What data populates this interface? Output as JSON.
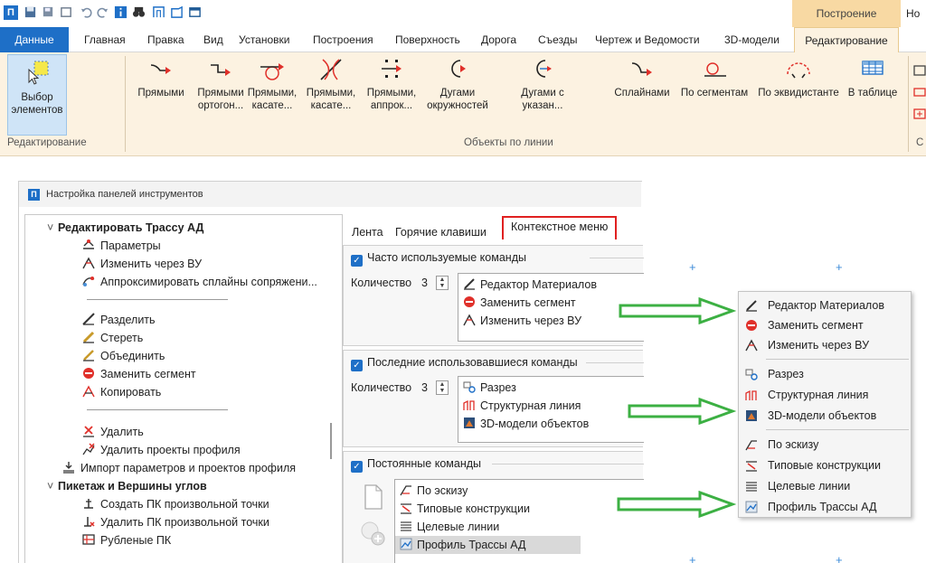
{
  "qat": {
    "logo": "П"
  },
  "contextual_tabs": {
    "build": "Построение",
    "more": "Но"
  },
  "tabs": [
    "Данные",
    "Главная",
    "Правка",
    "Вид",
    "Установки",
    "Построения",
    "Поверхность",
    "Дорога",
    "Съезды",
    "Чертеж и Ведомости",
    "3D-модели",
    "Редактирование"
  ],
  "ribbon": {
    "select_label": "Выбор\nэлементов",
    "group_edit": "Редактирование",
    "group_objects": "Объекты по линии",
    "group_more": "С",
    "buttons": [
      {
        "label": "Прямыми",
        "icon": "line-icon"
      },
      {
        "label": "Прямыми\nортогон...",
        "icon": "ortho-line-icon"
      },
      {
        "label": "Прямыми,\nкасате...",
        "icon": "tangent-circle-line-icon"
      },
      {
        "label": "Прямыми,\nкасате...",
        "icon": "tangent-arcs-line-icon"
      },
      {
        "label": "Прямыми,\nаппрок...",
        "icon": "approx-line-icon"
      },
      {
        "label": "Дугами\nокружностей",
        "icon": "arc-icon"
      },
      {
        "label": "Дугами с\nуказан...",
        "icon": "arc-direction-icon"
      },
      {
        "label": "Сплайнами",
        "icon": "spline-icon"
      },
      {
        "label": "По сегментам",
        "icon": "segments-icon"
      },
      {
        "label": "По эквидистанте",
        "icon": "equidistant-icon"
      },
      {
        "label": "В таблице",
        "icon": "table-icon"
      }
    ]
  },
  "dialog": {
    "logo": "П",
    "title": "Настройка панелей инструментов",
    "tree": {
      "section1": "Редактировать Трассу АД",
      "group1": [
        "Параметры",
        "Изменить через ВУ",
        "Аппроксимировать сплайны сопряжени..."
      ],
      "group2": [
        "Разделить",
        "Стереть",
        "Объединить",
        "Заменить сегмент",
        "Копировать"
      ],
      "group3": [
        "Удалить",
        "Удалить проекты профиля"
      ],
      "import": "Импорт параметров и проектов профиля",
      "section2": "Пикетаж и Вершины углов",
      "group4": [
        "Создать ПК произвольной точки",
        "Удалить ПК произвольной точки",
        "Рубленые ПК"
      ]
    },
    "tabs": [
      "Лента",
      "Горячие клавиши",
      "Контекстное меню"
    ],
    "frequent": {
      "title": "Часто используемые команды",
      "qty_label": "Количество",
      "qty": "3",
      "items": [
        "Редактор Материалов",
        "Заменить сегмент",
        "Изменить через ВУ"
      ]
    },
    "recent": {
      "title": "Последние использовавшиеся команды",
      "qty_label": "Количество",
      "qty": "3",
      "items": [
        "Разрез",
        "Структурная линия",
        "3D-модели объектов"
      ]
    },
    "permanent": {
      "title": "Постоянные команды",
      "items": [
        "По эскизу",
        "Типовые конструкции",
        "Целевые линии",
        "Профиль Трассы АД"
      ]
    }
  },
  "context_menu": {
    "section1": [
      "Редактор Материалов",
      "Заменить сегмент",
      "Изменить через ВУ"
    ],
    "section2": [
      "Разрез",
      "Структурная линия",
      "3D-модели объектов"
    ],
    "section3": [
      "По эскизу",
      "Типовые конструкции",
      "Целевые линии",
      "Профиль Трассы АД"
    ]
  },
  "colors": {
    "brand": "#1e6fc7",
    "ribbon_bg": "#fcf2e1",
    "context_tab": "#f8d9a3",
    "highlight_tab_border": "#e02020",
    "arrow_green": "#3cb043"
  }
}
